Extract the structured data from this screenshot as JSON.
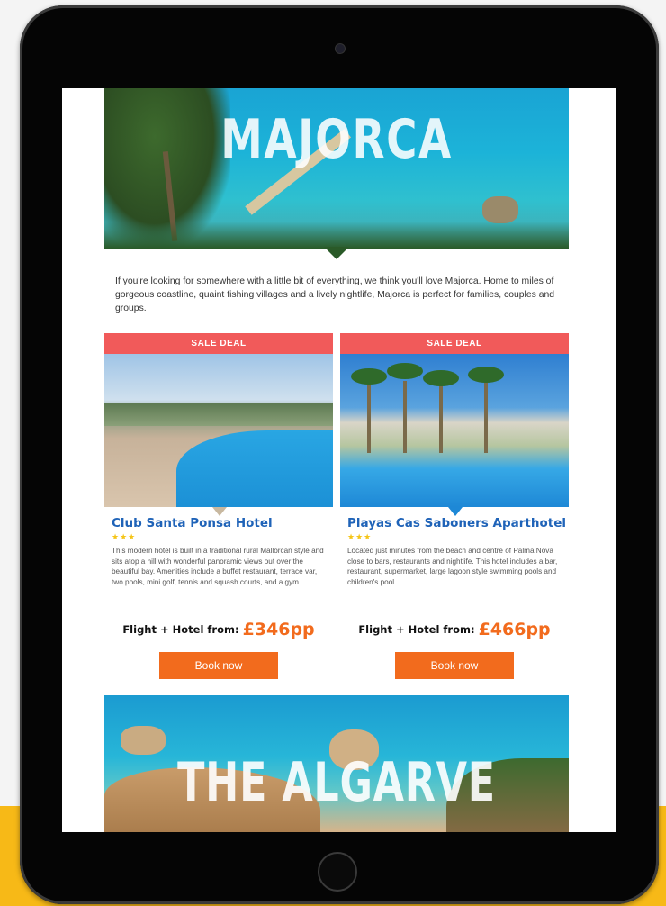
{
  "destination1": {
    "title": "MAJORCA",
    "intro": "If you're looking for somewhere with a little bit of everything, we think you'll love Majorca. Home to miles of gorgeous coastline, quaint fishing villages and a lively nightlife, Majorca is perfect for families, couples and groups."
  },
  "offers": [
    {
      "badge": "SALE DEAL",
      "name": "Club Santa Ponsa Hotel",
      "stars": "★★★",
      "rating": 3,
      "description": "This modern hotel is built in a traditional rural Mallorcan style and sits atop a hill with wonderful panoramic views out over the beautiful bay. Amenities include a buffet restaurant, terrace var, two pools, mini golf, tennis and squash courts, and a gym.",
      "price_label": "Flight + Hotel from:",
      "price": "£346pp",
      "button": "Book now"
    },
    {
      "badge": "SALE DEAL",
      "name": "Playas Cas Saboners Aparthotel",
      "stars": "★★★",
      "rating": 3,
      "description": "Located just minutes from the beach and centre of Palma Nova close to bars, restaurants and nightlife. This hotel includes a bar, restaurant, supermarket, large lagoon style swimming pools and children's pool.",
      "price_label": "Flight + Hotel from:",
      "price": "£466pp",
      "button": "Book now"
    }
  ],
  "destination2": {
    "title": "THE ALGARVE"
  },
  "colors": {
    "sale_badge": "#f15a5a",
    "hotel_name": "#1f63b8",
    "price": "#f26b1d",
    "button": "#f26b1d",
    "background_accent": "#f7b917"
  }
}
